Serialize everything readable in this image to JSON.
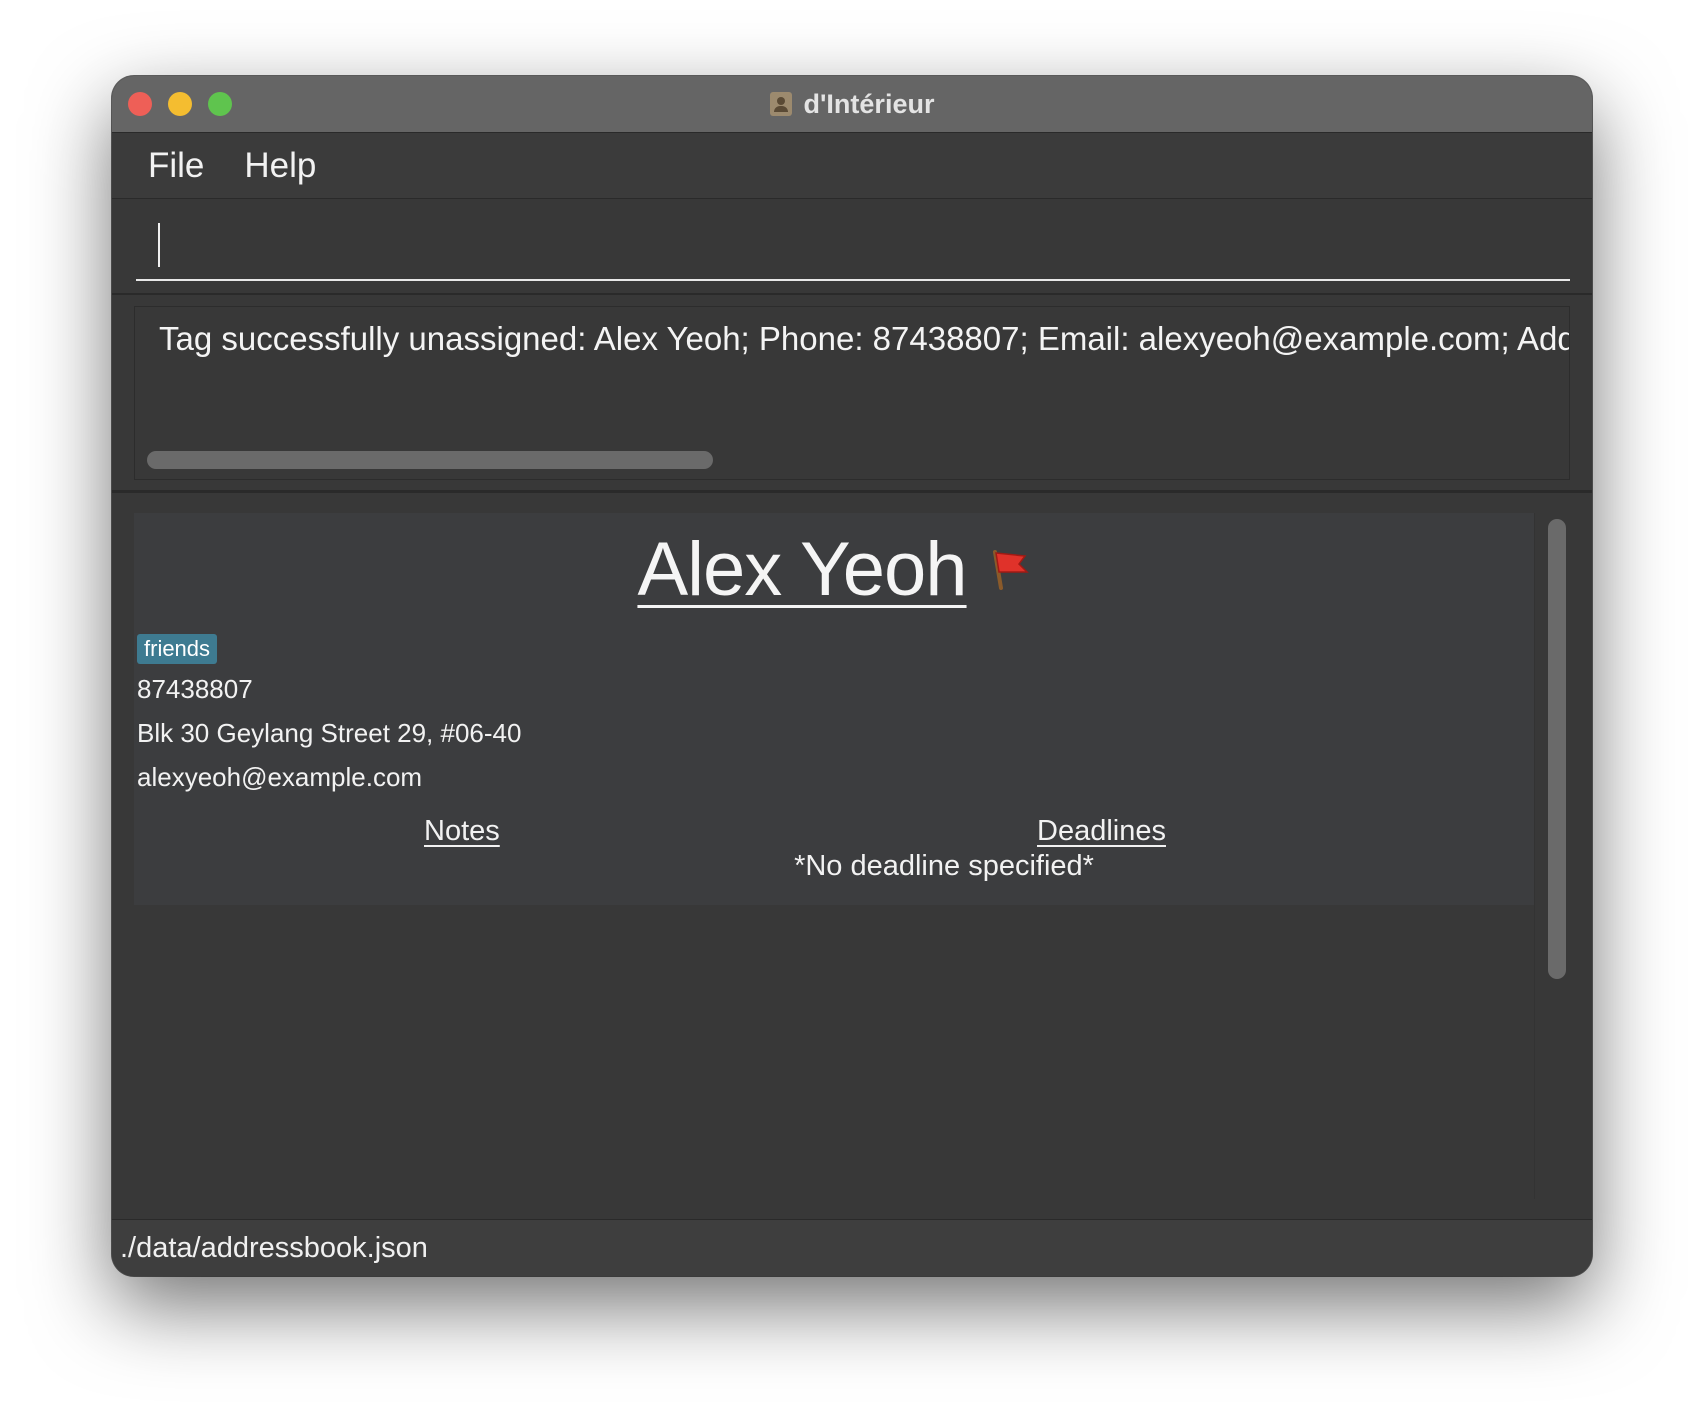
{
  "window": {
    "title": "d'Intérieur"
  },
  "menu": {
    "file": "File",
    "help": "Help"
  },
  "command": {
    "value": ""
  },
  "result": {
    "text": "Tag successfully unassigned: Alex Yeoh; Phone: 87438807; Email: alexyeoh@example.com; Addr"
  },
  "person": {
    "name": "Alex Yeoh",
    "tag": "friends",
    "phone": "87438807",
    "address": "Blk 30 Geylang Street 29, #06-40",
    "email": "alexyeoh@example.com",
    "notes_header": "Notes",
    "deadlines_header": "Deadlines",
    "no_deadline": "*No deadline specified*",
    "flag_icon": "red-flag-icon"
  },
  "status": {
    "path": "./data/addressbook.json"
  },
  "colors": {
    "tag_bg": "#3e7b91",
    "flag": "#e0322a"
  }
}
